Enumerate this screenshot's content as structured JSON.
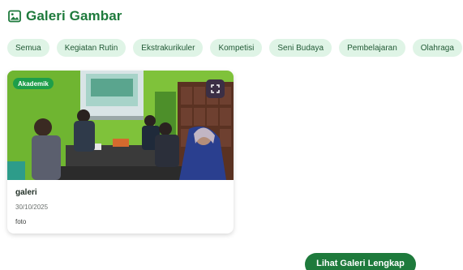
{
  "header": {
    "title": "Galeri Gambar",
    "icon": "image-icon"
  },
  "filters": [
    "Semua",
    "Kegiatan Rutin",
    "Ekstrakurikuler",
    "Kompetisi",
    "Seni Budaya",
    "Pembelajaran",
    "Olahraga"
  ],
  "card": {
    "badge": "Akademik",
    "title": "galeri",
    "date": "30/10/2025",
    "type": "foto",
    "media_button_icon": "fullscreen-icon"
  },
  "cta": {
    "label": "Lihat Galeri Lengkap"
  },
  "colors": {
    "brand": "#1e7a3c",
    "chip_bg": "#dff4e6",
    "badge_bg": "#1e9e4a"
  }
}
